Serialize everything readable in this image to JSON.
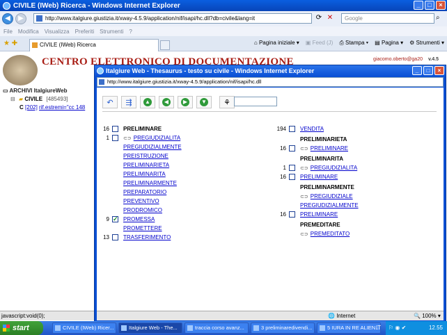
{
  "browser": {
    "title": "CIVILE (IWeb) Ricerca - Windows Internet Explorer",
    "address": "http://www.italgiure.giustizia.it/xway-4.5.9/application/nif/isapi/hc.dll?db=civile&lang=it",
    "search_placeholder": "Google",
    "menu": [
      "File",
      "Modifica",
      "Visualizza",
      "Preferiti",
      "Strumenti",
      "?"
    ],
    "tab_label": "CIVILE (IWeb) Ricerca",
    "commands": {
      "home": "Pagina iniziale",
      "feed": "Feed (J)",
      "print": "Stampa",
      "page": "Pagina",
      "tools": "Strumenti"
    },
    "status": "javascript:void(0);"
  },
  "page": {
    "banner_title": "CENTRO ELETTRONICO DI DOCUMENTAZIONE",
    "user": "giacomo.oberto@ga20",
    "version": "v.4.5",
    "tree": {
      "root": "ARCHIVI ItalgiureWeb",
      "archive": "CIVILE",
      "archive_count": "[485493]",
      "item_prefix": "C",
      "item_num": "[202]",
      "item_text": "rif.estremi=\"cc 148"
    }
  },
  "popup": {
    "title": "Italgiure Web - Thesaurus - testo su civile - Windows Internet Explorer",
    "address": "http://www.italgiure.giustizia.it/xway-4.5.9/application/nif/isapi/hc.dll",
    "status_zone": "Internet",
    "zoom": "100%",
    "left": [
      {
        "num": "16",
        "cb": true,
        "checked": false,
        "text": "PRELIMINARE",
        "kind": "header"
      },
      {
        "num": "1",
        "cb": true,
        "checked": false,
        "text": "PREGIUDIZIALITA",
        "kind": "link",
        "arrow": true
      },
      {
        "num": "",
        "cb": false,
        "text": "PREGIUDIZIALMENTE",
        "kind": "link"
      },
      {
        "num": "",
        "cb": false,
        "text": "PREISTRUZIONE",
        "kind": "link"
      },
      {
        "num": "",
        "cb": false,
        "text": "PRELIMINARIETA",
        "kind": "link"
      },
      {
        "num": "",
        "cb": false,
        "text": "PRELIMINARITA",
        "kind": "link"
      },
      {
        "num": "",
        "cb": false,
        "text": "PRELIMINARMENTE",
        "kind": "link"
      },
      {
        "num": "",
        "cb": false,
        "text": "PREPARATORIO",
        "kind": "link"
      },
      {
        "num": "",
        "cb": false,
        "text": "PREVENTIVO",
        "kind": "link"
      },
      {
        "num": "",
        "cb": false,
        "text": "PRODROMICO",
        "kind": "link"
      },
      {
        "num": "9",
        "cb": true,
        "checked": true,
        "text": "PROMESSA",
        "kind": "link"
      },
      {
        "num": "",
        "cb": false,
        "text": "PROMETTERE",
        "kind": "link"
      },
      {
        "num": "13",
        "cb": true,
        "checked": false,
        "text": "TRASFERIMENTO",
        "kind": "link"
      }
    ],
    "right": [
      {
        "num": "194",
        "cb": true,
        "checked": false,
        "text": "VENDITA",
        "kind": "link"
      },
      {
        "num": "",
        "cb": false,
        "text": "PRELIMINARIETA",
        "kind": "header"
      },
      {
        "num": "16",
        "cb": true,
        "checked": false,
        "text": "PRELIMINARE",
        "kind": "link",
        "arrow": true
      },
      {
        "num": "",
        "cb": false,
        "text": "PRELIMINARITA",
        "kind": "header"
      },
      {
        "num": "1",
        "cb": true,
        "checked": false,
        "text": "PREGIUDIZIALITA",
        "kind": "link",
        "arrow": true
      },
      {
        "num": "16",
        "cb": true,
        "checked": false,
        "text": "PRELIMINARE",
        "kind": "link"
      },
      {
        "num": "",
        "cb": false,
        "text": "PRELIMINARMENTE",
        "kind": "header"
      },
      {
        "num": "",
        "cb": false,
        "text": "PREGIUDIZIALE",
        "kind": "link",
        "arrow": true
      },
      {
        "num": "",
        "cb": false,
        "text": "PREGIUDIZIALMENTE",
        "kind": "link"
      },
      {
        "num": "16",
        "cb": true,
        "checked": false,
        "text": "PRELIMINARE",
        "kind": "link"
      },
      {
        "num": "",
        "cb": false,
        "text": "PREMEDITARE",
        "kind": "header"
      },
      {
        "num": "",
        "cb": false,
        "text": "PREMEDITATO",
        "kind": "link",
        "arrow": true
      }
    ]
  },
  "taskbar": {
    "start": "start",
    "tasks": [
      "CIVILE (IWeb) Ricer...",
      "Italgiure Web - The...",
      "traccia corso avanz...",
      "3 preliminaredivendi...",
      "5 IURA IN RE ALIEN..."
    ],
    "lang": "IT",
    "clock": "12.55"
  }
}
